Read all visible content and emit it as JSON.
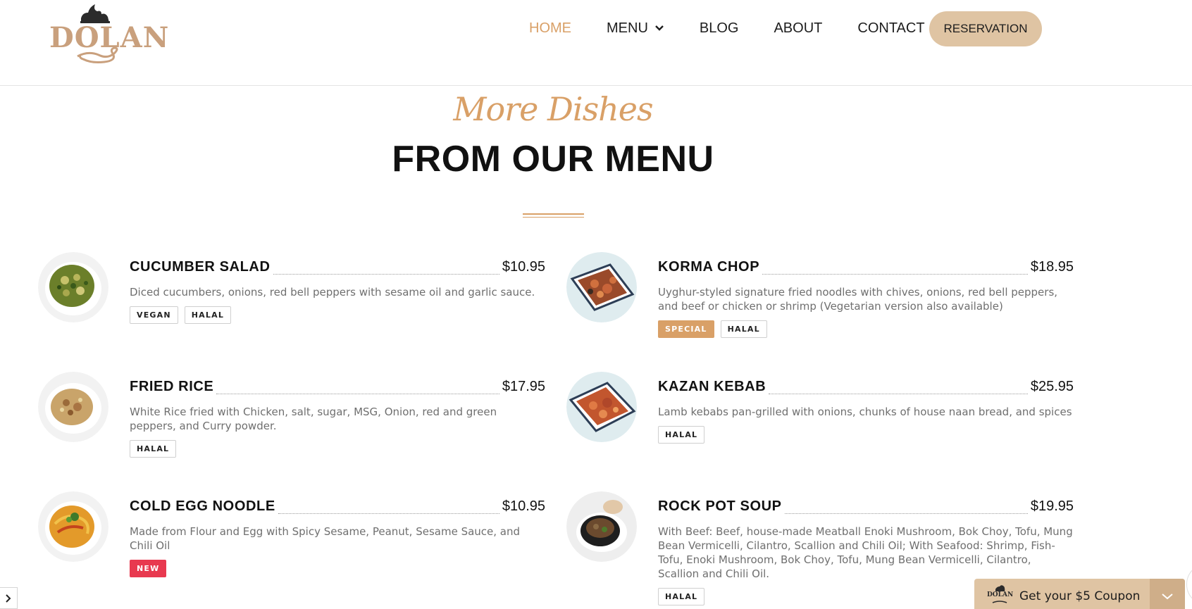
{
  "header": {
    "logo_text": "DOLAN",
    "nav": [
      {
        "label": "HOME",
        "active": true
      },
      {
        "label": "MENU",
        "has_dropdown": true
      },
      {
        "label": "BLOG"
      },
      {
        "label": "ABOUT"
      },
      {
        "label": "CONTACT"
      }
    ],
    "reservation_label": "RESERVATION"
  },
  "section": {
    "script_title": "More Dishes",
    "title": "FROM OUR MENU"
  },
  "menu": [
    {
      "name": "CUCUMBER SALAD",
      "price": "$10.95",
      "description": "Diced cucumbers, onions, red bell peppers with sesame oil and garlic sauce.",
      "tags": [
        "VEGAN",
        "HALAL"
      ]
    },
    {
      "name": "KORMA CHOP",
      "price": "$18.95",
      "description": "Uyghur-styled signature fried noodles with chives, onions, red bell peppers, and beef or chicken or shrimp (Vegetarian version also available)",
      "tags": [
        "SPECIAL",
        "HALAL"
      ]
    },
    {
      "name": "FRIED RICE",
      "price": "$17.95",
      "description": "White Rice fried with Chicken, salt, sugar, MSG, Onion, red and green peppers, and Curry powder.",
      "tags": [
        "HALAL"
      ]
    },
    {
      "name": "KAZAN KEBAB",
      "price": "$25.95",
      "description": "Lamb kebabs pan-grilled with onions, chunks of house naan bread, and spices",
      "tags": [
        "HALAL"
      ]
    },
    {
      "name": "COLD EGG NOODLE",
      "price": "$10.95",
      "description": "Made from Flour and Egg with Spicy Sesame, Peanut, Sesame Sauce, and Chili Oil",
      "tags": [
        "NEW"
      ]
    },
    {
      "name": "ROCK POT SOUP",
      "price": "$19.95",
      "description": "With Beef: Beef, house-made Meatball Enoki Mushroom, Bok Choy, Tofu, Mung Bean Vermicelli, Cilantro, Scallion and Chili Oil; With Seafood: Shrimp, Fish-Tofu, Enoki Mushroom, Bok Choy, Tofu, Mung Bean Vermicelli, Cilantro, Scallion and Chili Oil.",
      "tags": [
        "HALAL"
      ]
    }
  ],
  "coupon": {
    "label": "Get your $5 Coupon",
    "logo_text": "DOLAN"
  },
  "colors": {
    "accent": "#d9a067",
    "button_bg": "#dfc4a3",
    "new_badge": "#e8394f",
    "logo": "#c9a07d"
  },
  "icons": {
    "menu_dropdown": "chevron-down-icon",
    "coupon_toggle": "chevron-down-icon",
    "side_tab": "chevron-right-icon"
  }
}
